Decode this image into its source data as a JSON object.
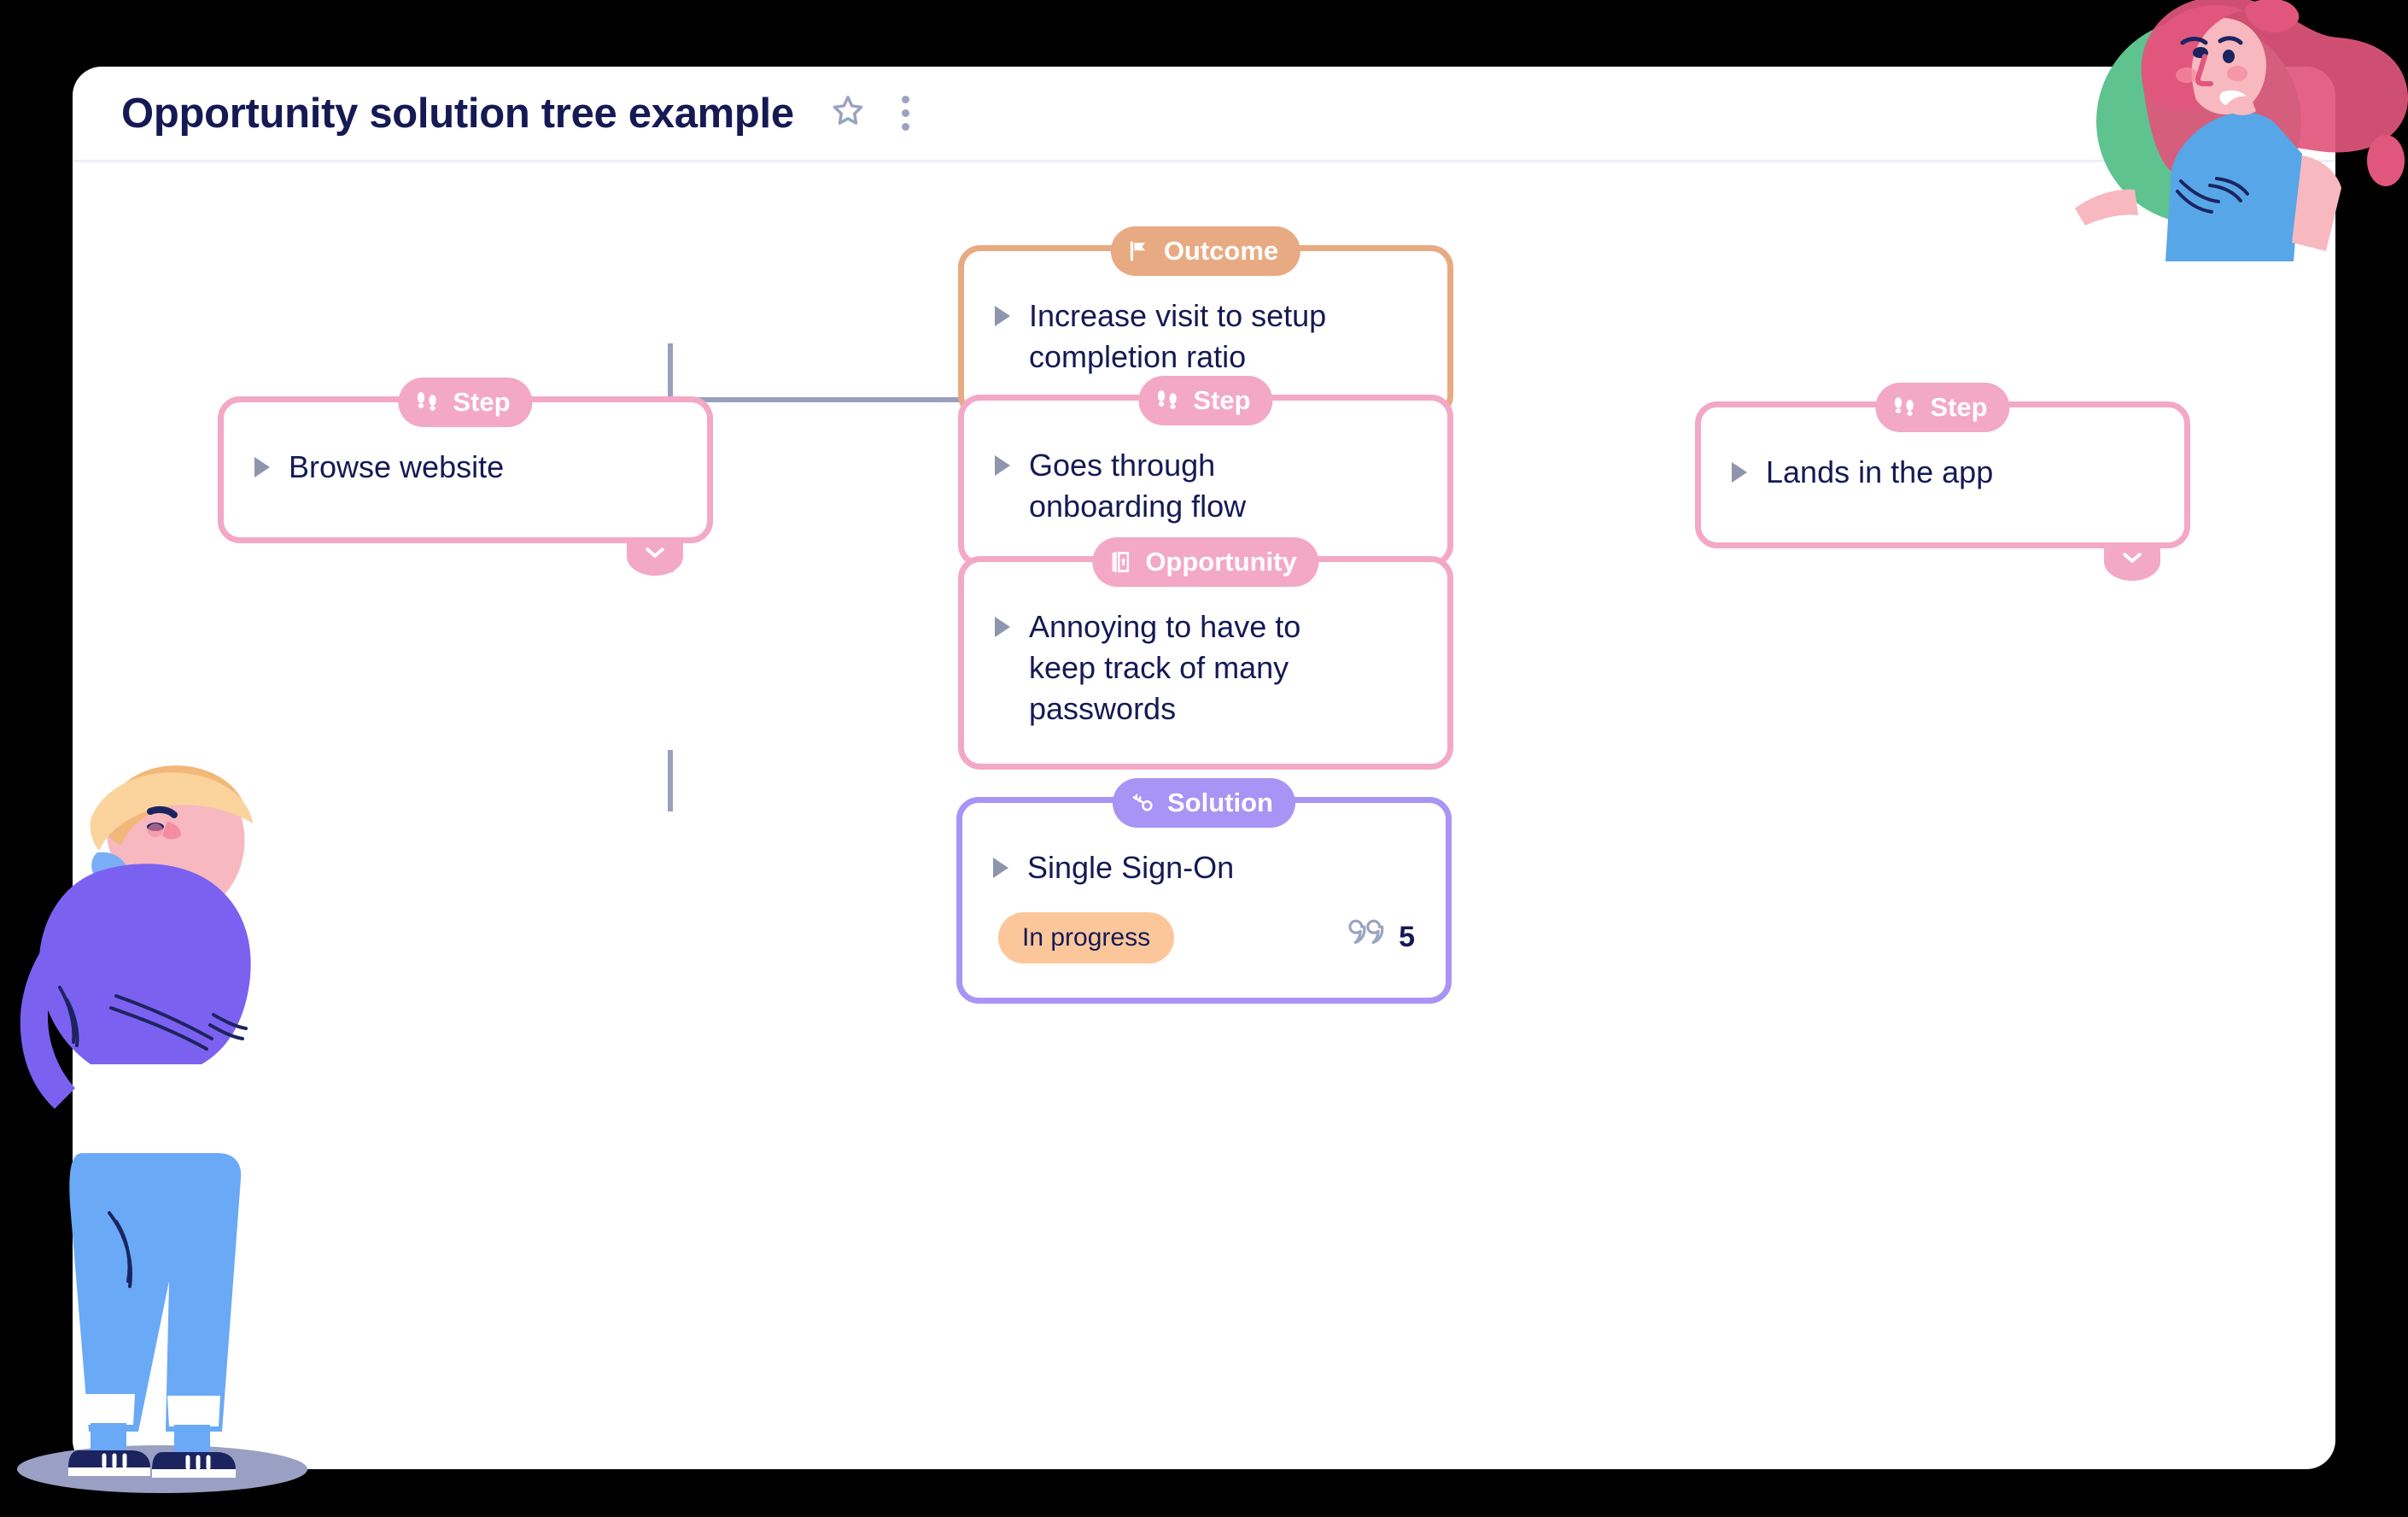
{
  "header": {
    "title": "Opportunity solution tree example",
    "star_icon": "star-icon",
    "menu_icon": "kebab-menu-icon"
  },
  "tree": {
    "outcome": {
      "badge": "Outcome",
      "badge_icon": "flag-icon",
      "text": "Increase visit to setup completion ratio",
      "accent": "#e8aa82"
    },
    "steps": [
      {
        "badge": "Step",
        "badge_icon": "footprints-icon",
        "text": "Browse website",
        "accent": "#f3a8c6",
        "has_expander": true,
        "expander_icon": "chevron-down-icon"
      },
      {
        "badge": "Step",
        "badge_icon": "footprints-icon",
        "text": "Goes through onboarding flow",
        "accent": "#f3a8c6",
        "has_expander": false
      },
      {
        "badge": "Step",
        "badge_icon": "footprints-icon",
        "text": "Lands in the app",
        "accent": "#f3a8c6",
        "has_expander": true,
        "expander_icon": "chevron-down-icon"
      }
    ],
    "opportunity": {
      "badge": "Opportunity",
      "badge_icon": "door-icon",
      "text": "Annoying to have to keep track of many passwords",
      "accent": "#f3a8c6"
    },
    "solution": {
      "badge": "Solution",
      "badge_icon": "key-icon",
      "text": "Single Sign-On",
      "status": "In progress",
      "status_color": "#fbc79a",
      "comment_icon": "quote-icon",
      "comment_count": "5",
      "accent": "#a894f5"
    },
    "connector_color": "#98a0bd"
  },
  "decorations": {
    "woman_illustration": "woman-waving-illustration",
    "man_illustration": "man-thinking-illustration"
  }
}
